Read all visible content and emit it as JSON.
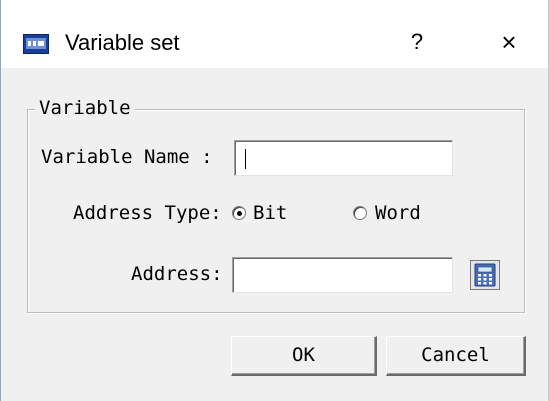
{
  "window": {
    "title": "Variable set",
    "help_label": "?",
    "close_label": "×"
  },
  "group": {
    "legend": "Variable",
    "variable_name_label": "Variable Name :",
    "variable_name_value": "",
    "address_type_label": "Address Type:",
    "radio_bit_label": "Bit",
    "radio_word_label": "Word",
    "address_type_selected": "Bit",
    "address_label": "Address:",
    "address_value": ""
  },
  "buttons": {
    "ok_label": "OK",
    "cancel_label": "Cancel"
  },
  "colors": {
    "window_bg": "#f0f0f0",
    "titlebar_bg": "#ffffff",
    "icon_blue": "#1a3f9a"
  },
  "icons": {
    "app": "hmi-window-icon",
    "calculator": "calculator-icon"
  }
}
